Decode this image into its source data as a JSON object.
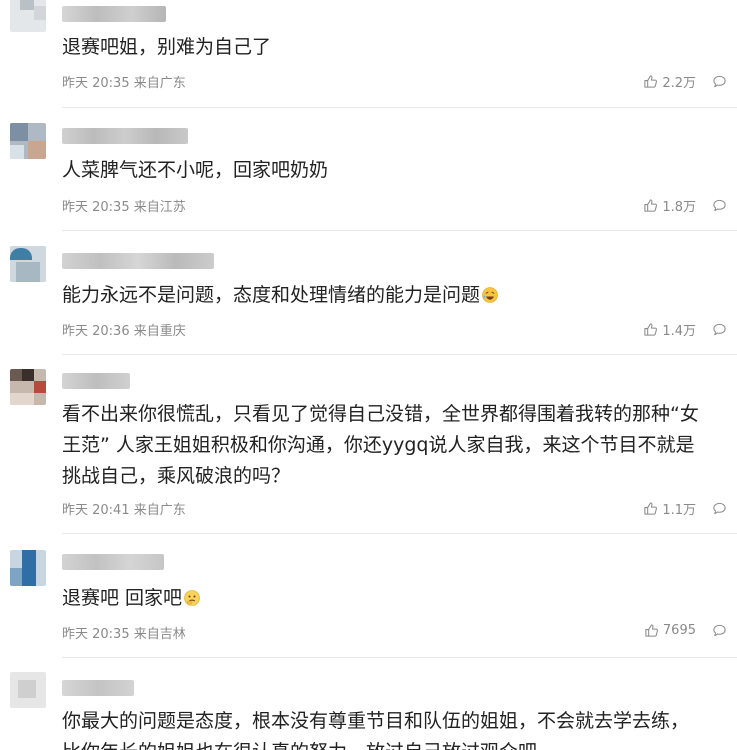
{
  "comments": [
    {
      "text": "退赛吧姐，别难为自己了",
      "time": "昨天 20:35",
      "location": "来自广东",
      "likes": "2.2万"
    },
    {
      "text": "人菜脾气还不小呢，回家吧奶奶",
      "time": "昨天 20:35",
      "location": "来自江苏",
      "likes": "1.8万"
    },
    {
      "text": "能力永远不是问题，态度和处理情绪的能力是问题",
      "time": "昨天 20:36",
      "location": "来自重庆",
      "likes": "1.4万",
      "emoji": "laughing-tears-emoji"
    },
    {
      "text_lines": [
        "看不出来你很慌乱，只看见了觉得自己没错，全世界都得围着我转的那种“女",
        "王范” 人家王姐姐积极和你沟通，你还yygq说人家自我，来这个节目不就是",
        "挑战自己，乘风破浪的吗？"
      ],
      "time": "昨天 20:41",
      "location": "来自广东",
      "likes": "1.1万"
    },
    {
      "text": "退赛吧 回家吧",
      "time": "昨天 20:35",
      "location": "来自吉林",
      "likes": "7695",
      "emoji": "thinking-emoji"
    },
    {
      "text_lines": [
        "你最大的问题是态度，根本没有尊重节目和队伍的姐姐，不会就去学去练，",
        "比你年长的姐姐也在很认真的努力，放过自己放过观众吧"
      ]
    }
  ],
  "icons": {
    "like": "thumbs-up-icon",
    "reply": "comment-bubble-icon"
  },
  "colors": {
    "text": "#222222",
    "meta": "#8a8a8a",
    "divider": "#e8e8e8"
  }
}
